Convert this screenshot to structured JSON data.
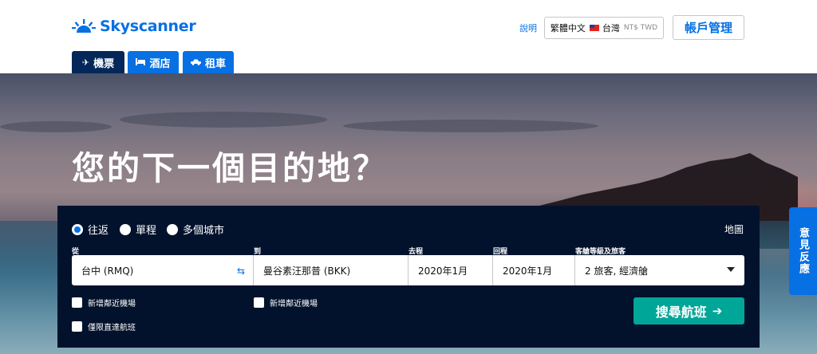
{
  "header": {
    "logo_text": "Skyscanner",
    "help_label": "說明",
    "locale": {
      "language": "繁體中文",
      "country": "台灣",
      "currency": "NT$ TWD"
    },
    "account_label": "帳戶管理"
  },
  "tabs": [
    {
      "label": "機票",
      "icon": "plane-icon",
      "active": true
    },
    {
      "label": "酒店",
      "icon": "bed-icon",
      "active": false
    },
    {
      "label": "租車",
      "icon": "car-icon",
      "active": false
    }
  ],
  "hero": {
    "headline": "您的下一個目的地？",
    "feedback_label": "意見反應"
  },
  "search": {
    "trip_types": [
      {
        "label": "往返",
        "selected": true
      },
      {
        "label": "單程",
        "selected": false
      },
      {
        "label": "多個城市",
        "selected": false
      }
    ],
    "map_label": "地圖",
    "labels": {
      "from": "從",
      "to": "到",
      "depart": "去程",
      "return": "回程",
      "cabin": "客艙等級及旅客"
    },
    "values": {
      "from": "台中 (RMQ)",
      "to": "曼谷素汪那普 (BKK)",
      "depart": "2020年1月",
      "return": "2020年1月",
      "cabin": "2 旅客, 經濟艙"
    },
    "checkboxes": {
      "nearby_from": "新增鄰近機場",
      "nearby_to": "新增鄰近機場",
      "direct_only": "僅限直達航班"
    },
    "submit_label": "搜尋航班",
    "submit_icon": "arrow-right-icon"
  },
  "colors": {
    "brand_blue": "#0770e3",
    "active_tab": "#042759",
    "panel_bg": "#02122c",
    "search_button": "#00a698"
  }
}
